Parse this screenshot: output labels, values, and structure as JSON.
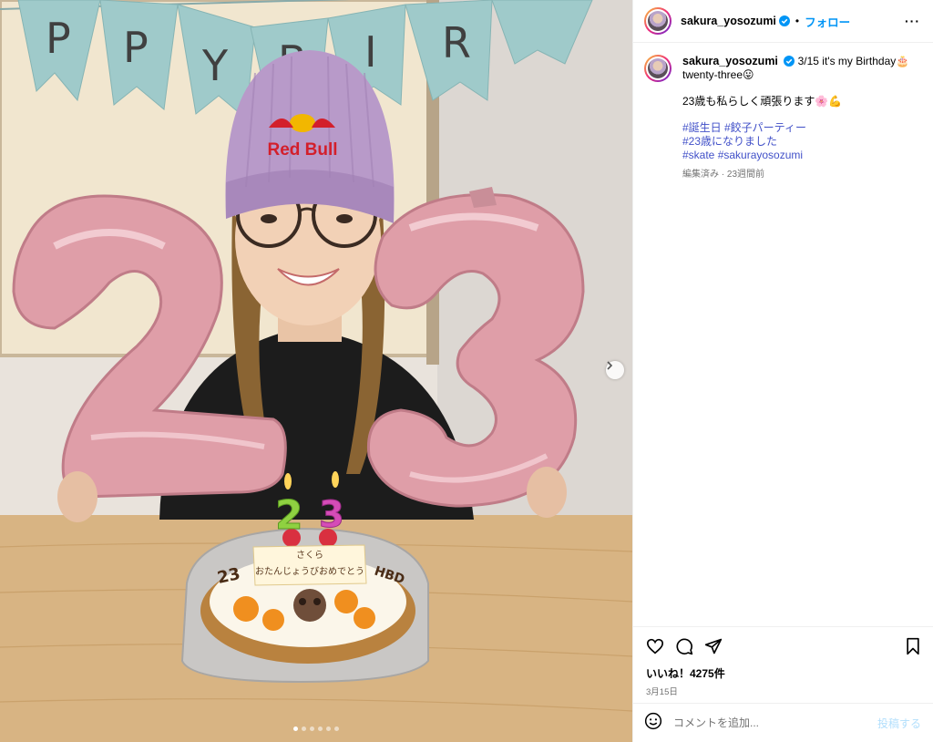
{
  "post": {
    "username": "sakura_yosozumi",
    "follow_label": "フォロー",
    "separator": "•",
    "more_label": "···"
  },
  "caption": {
    "username": "sakura_yosozumi",
    "line1": "3/15 it's my Birthday🎂",
    "line2": "twenty-three😛",
    "line3": "23歳も私らしく頑張ります🌸💪",
    "hashtags_line1": "#誕生日 #餃子パーティー",
    "hashtags_line2": "#23歳になりました",
    "hashtags_line3": "#skate #sakurayosozumi",
    "meta": "編集済み · 23週間前"
  },
  "engagement": {
    "likes": "いいね！4275件",
    "date": "3月15日"
  },
  "comment": {
    "placeholder": "コメントを追加...",
    "post_label": "投稿する"
  },
  "photo": {
    "banner_letters": [
      "P",
      "P",
      "Y",
      "B",
      "I",
      "R"
    ],
    "beanie_logo": "Red Bull",
    "balloon_digit_left": "2",
    "balloon_digit_right": "3",
    "cake_plaque_name": "さくら",
    "cake_plaque_message": "おたんじょうびおめでとう",
    "cake_side_left": "23",
    "cake_side_right": "HBD",
    "candle_left": "2",
    "candle_right": "3",
    "carousel_count": 6,
    "carousel_active_index": 0
  },
  "colors": {
    "accent": "#0095f6",
    "hashtag": "#4150c8",
    "muted": "#737373"
  }
}
